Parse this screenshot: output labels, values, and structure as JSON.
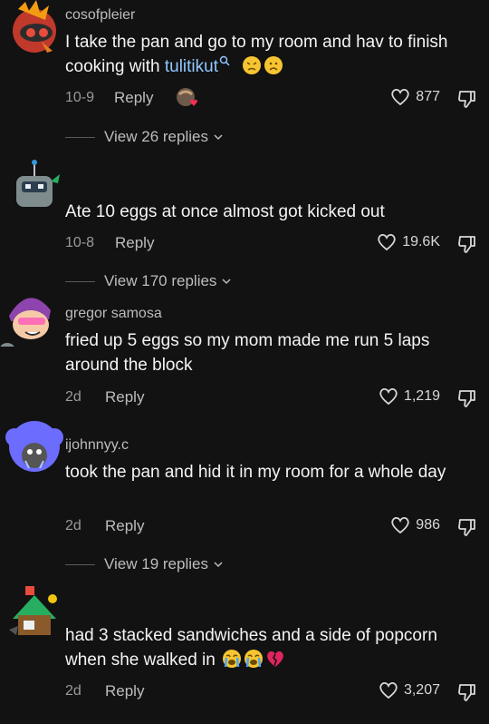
{
  "comments": [
    {
      "username": "cosofpleier",
      "text_before": "I take the pan and go to my room and hav to finish cooking with ",
      "mention": "tulitikut",
      "date": "10-9",
      "reply_label": "Reply",
      "likes": "877",
      "view_replies": "View 26 replies",
      "emojis": [
        "confounded-face-icon",
        "frowning-face-icon"
      ]
    },
    {
      "username": "",
      "text": "Ate 10 eggs at once almost got kicked out",
      "date": "10-8",
      "reply_label": "Reply",
      "likes": "19.6K",
      "view_replies": "View 170 replies"
    },
    {
      "username": "gregor samosa",
      "text": "fried up 5 eggs so my mom made me run 5 laps around the block",
      "date": "2d",
      "reply_label": "Reply",
      "likes": "1,219"
    },
    {
      "username": "ijohnnyy.c",
      "text": "took the pan and hid it in my room for a whole day",
      "date": "2d",
      "reply_label": "Reply",
      "likes": "986",
      "view_replies": "View 19 replies"
    },
    {
      "username": "",
      "text": "had 3 stacked sandwiches and a side of popcorn when she walked in ",
      "date": "2d",
      "reply_label": "Reply",
      "likes": "3,207",
      "emojis": [
        "crying-face-icon",
        "crying-face-icon",
        "broken-heart-icon"
      ]
    }
  ],
  "colors": {
    "background": "#121212",
    "mention": "#8fc7ff",
    "muted": "#9a9a9a"
  }
}
